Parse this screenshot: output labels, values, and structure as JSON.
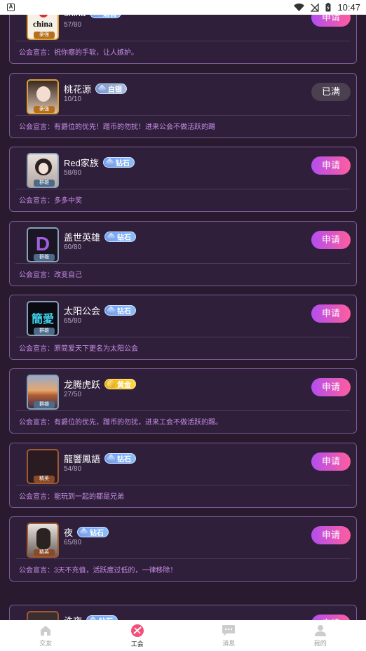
{
  "status_bar": {
    "time": "10:47",
    "app_icon_letter": "A"
  },
  "guilds": [
    {
      "name": "china",
      "badge": "钻石",
      "badge_type": "diamond",
      "count": "57/80",
      "button": "申请",
      "button_state": "apply",
      "motto": "公会宣言：祝你瘪的手软，让人嫉妒。",
      "frame_tag": "豪强",
      "avatar_text": "china"
    },
    {
      "name": "桃花源",
      "badge": "白银",
      "badge_type": "silver",
      "count": "10/10",
      "button": "已满",
      "button_state": "full",
      "motto": "公会宣言：有爵位的优先！蹭币的勿扰！进来公会不做活跃的踢",
      "frame_tag": "豪强",
      "avatar_text": ""
    },
    {
      "name": "Red家族",
      "badge": "钻石",
      "badge_type": "diamond",
      "count": "58/80",
      "button": "申请",
      "button_state": "apply",
      "motto": "公会宣言：多多中奖",
      "frame_tag": "群雄",
      "avatar_text": ""
    },
    {
      "name": "盖世英雄",
      "badge": "钻石",
      "badge_type": "diamond",
      "count": "60/80",
      "button": "申请",
      "button_state": "apply",
      "motto": "公会宣言：改变自己",
      "frame_tag": "群雄",
      "avatar_text": "D"
    },
    {
      "name": "太阳公会",
      "badge": "钻石",
      "badge_type": "diamond",
      "count": "65/80",
      "button": "申请",
      "button_state": "apply",
      "motto": "公会宣言：原简爱天下更名为太阳公会",
      "frame_tag": "群雄",
      "avatar_text": "簡愛"
    },
    {
      "name": "龙腾虎跃",
      "badge": "黄金",
      "badge_type": "gold",
      "count": "27/50",
      "button": "申请",
      "button_state": "apply",
      "motto": "公会宣言：有爵位的优先，蹭币的勿扰，进来工会不做活跃的踢。",
      "frame_tag": "群雄",
      "avatar_text": ""
    },
    {
      "name": "龍響鳳語",
      "badge": "钻石",
      "badge_type": "diamond",
      "count": "54/80",
      "button": "申请",
      "button_state": "apply",
      "motto": "公会宣言：能玩到一起的都是兄弟",
      "frame_tag": "精英",
      "avatar_text": ""
    },
    {
      "name": "夜",
      "badge": "钻石",
      "badge_type": "diamond",
      "count": "65/80",
      "button": "申请",
      "button_state": "apply",
      "motto": "公会宣言：3天不充值，活跃度过低的，一律移除！",
      "frame_tag": "精英",
      "avatar_text": ""
    },
    {
      "name": "诛夜",
      "badge": "钻石",
      "badge_type": "diamond",
      "count": "",
      "button": "申请",
      "button_state": "apply",
      "motto": "",
      "frame_tag": "",
      "avatar_text": ""
    }
  ],
  "tabbar": [
    {
      "label": "交友",
      "icon": "home-icon",
      "active": false
    },
    {
      "label": "工会",
      "icon": "guild-icon",
      "active": true
    },
    {
      "label": "消息",
      "icon": "message-icon",
      "active": false
    },
    {
      "label": "我的",
      "icon": "profile-icon",
      "active": false
    }
  ],
  "colors": {
    "accent_gradient_start": "#b24ef0",
    "accent_gradient_end": "#ff5d9e",
    "card_bg": "#2f1f3a",
    "card_border": "#7c5a92",
    "motto": "#c98ee8"
  }
}
